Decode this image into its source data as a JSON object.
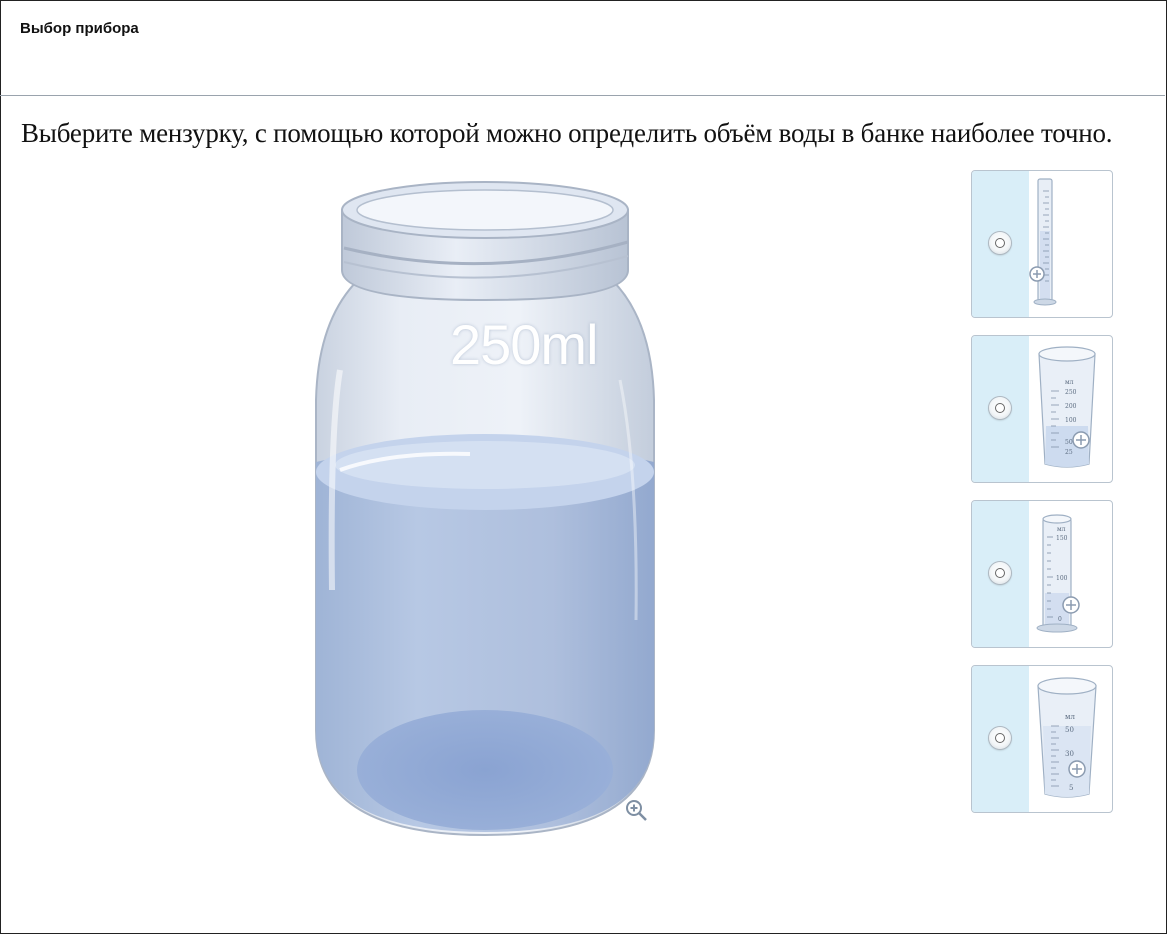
{
  "header": {
    "title": "Выбор прибора"
  },
  "question": {
    "text": "Выберите мензурку, с помощью которой можно определить объём воды в банке наиболее точно."
  },
  "jar": {
    "label": "250ml",
    "zoom_icon": "zoom-in-icon"
  },
  "options": [
    {
      "id": "tall-cylinder",
      "icon": "graduated-cylinder-icon",
      "selected": false
    },
    {
      "id": "beaker-250",
      "icon": "beaker-icon",
      "unit": "мл",
      "scale": [
        "250",
        "200",
        "100",
        "50",
        "25"
      ],
      "selected": false
    },
    {
      "id": "cylinder-150",
      "icon": "graduated-cylinder-icon",
      "unit": "мл",
      "scale": [
        "150",
        "100",
        "0"
      ],
      "selected": false
    },
    {
      "id": "beaker-50",
      "icon": "beaker-icon",
      "unit": "мл",
      "scale": [
        "50",
        "30",
        "5"
      ],
      "selected": false
    }
  ],
  "colors": {
    "water": "#a9c0e0",
    "panel_bg": "#d9eef8",
    "border": "#b9c4cf"
  }
}
